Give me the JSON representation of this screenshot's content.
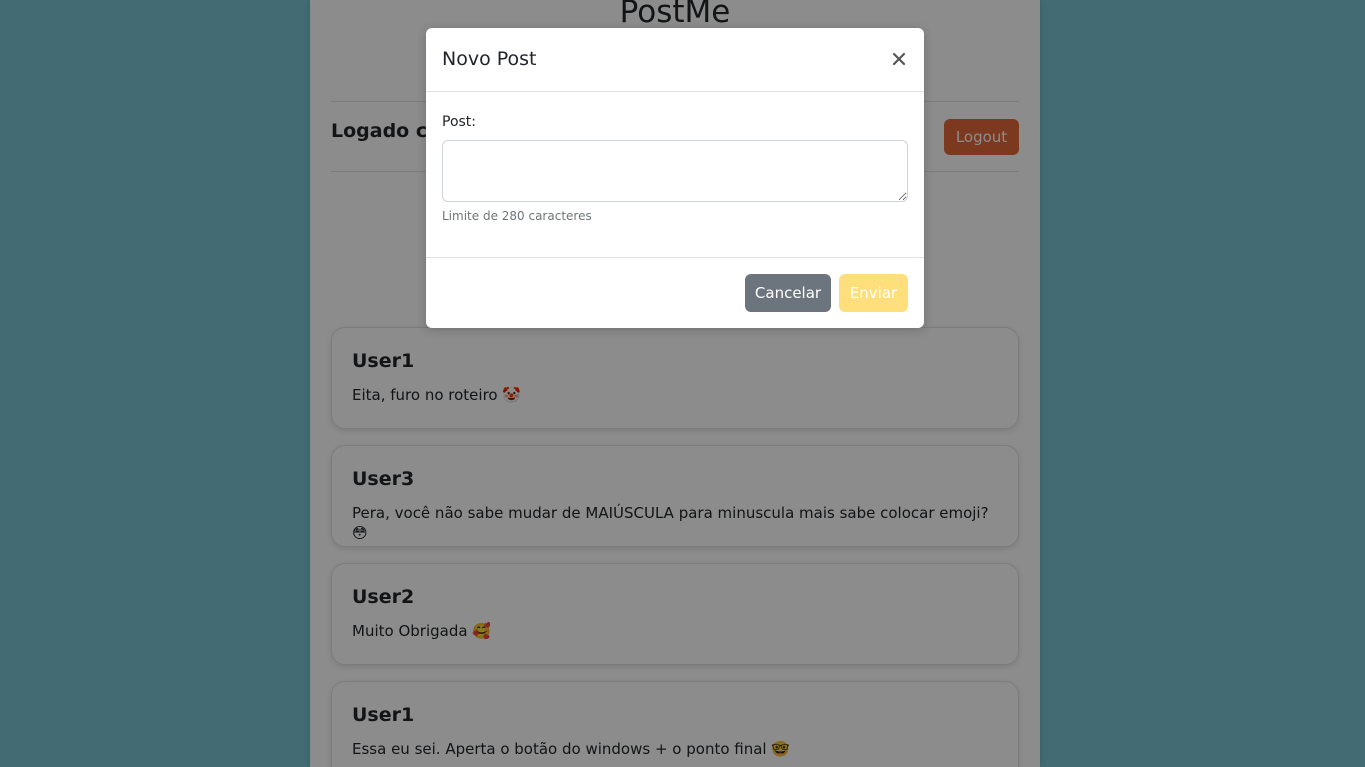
{
  "app": {
    "title": "PostMe"
  },
  "header": {
    "logged_in_text": "Logado co",
    "logout_label": "Logout"
  },
  "posts": [
    {
      "user": "User1",
      "text": "Eita, furo no roteiro 🤡"
    },
    {
      "user": "User3",
      "text": "Pera, você não sabe mudar de MAIÚSCULA para minuscula mais sabe colocar emoji? 😳"
    },
    {
      "user": "User2",
      "text": "Muito Obrigada 🥰"
    },
    {
      "user": "User1",
      "text": "Essa eu sei. Aperta o botão do windows + o ponto final 🤓"
    }
  ],
  "modal": {
    "title": "Novo Post",
    "close_icon": "close-icon",
    "field_label": "Post:",
    "textarea_value": "",
    "help_text": "Limite de 280 caracteres",
    "cancel_label": "Cancelar",
    "send_label": "Enviar"
  },
  "colors": {
    "page_background": "#78c3d3",
    "logout_button": "#e4683a",
    "cancel_button": "#6c757d",
    "send_button": "#ffd966"
  }
}
